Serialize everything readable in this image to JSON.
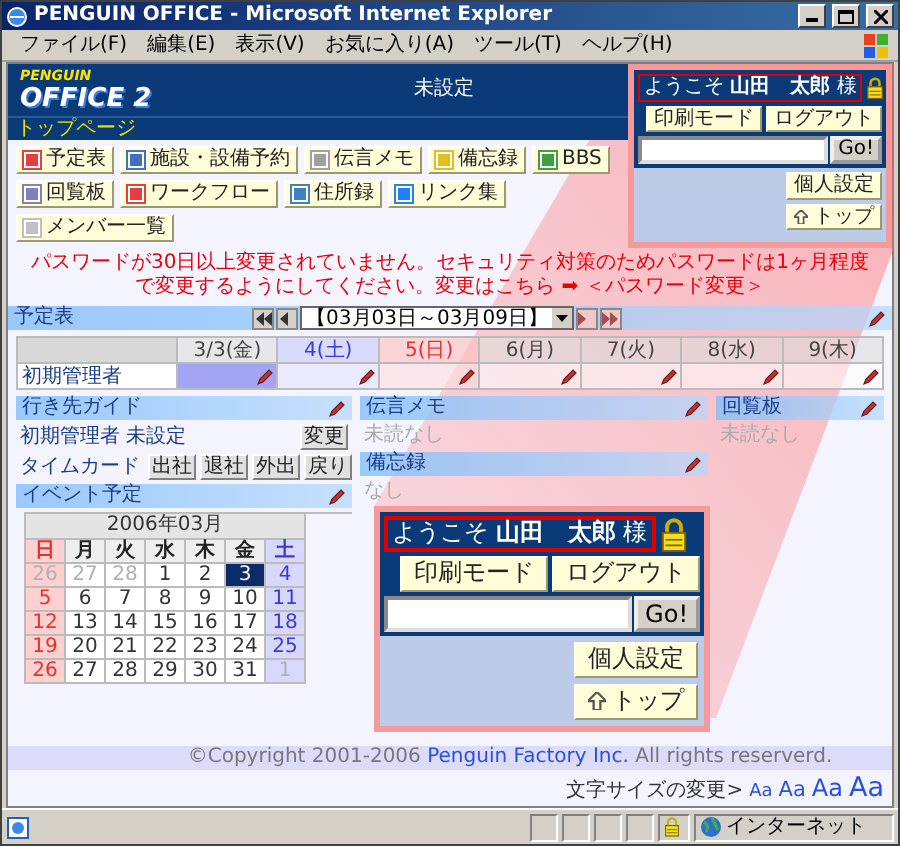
{
  "window": {
    "title": "PENGUIN OFFICE - Microsoft Internet Explorer"
  },
  "menu": [
    "ファイル(F)",
    "編集(E)",
    "表示(V)",
    "お気に入り(A)",
    "ツール(T)",
    "ヘルプ(H)"
  ],
  "logo": {
    "top": "PENGUIN",
    "bottom": "OFFICE 2"
  },
  "page_title": "未設定",
  "breadcrumb": "トップページ",
  "app_buttons": [
    "予定表",
    "施設・設備予約",
    "伝言メモ",
    "備忘録",
    "BBS",
    "回覧板",
    "ワークフロー",
    "住所録",
    "リンク集",
    "メンバー一覧"
  ],
  "user_panel": {
    "welcome": "ようこそ **山田　太郎** 様",
    "buttons": [
      "印刷モード",
      "ログアウト"
    ],
    "search_button": "Go!",
    "settings_button": "個人設定",
    "top_button": "トップ"
  },
  "warning": {
    "text": "パスワードが30日以上変更されていません。セキュリティ対策のためパスワードは1ヶ月程度で変更するようにしてください。変更はこちら ➡",
    "link": "＜パスワード変更＞"
  },
  "schedule": {
    "title": "予定表",
    "range": "【03月03日～03月09日】",
    "days": [
      {
        "label": "3/3(金)",
        "kind": "weekday",
        "selected": true
      },
      {
        "label": "4(土)",
        "kind": "saturday",
        "selected": false
      },
      {
        "label": "5(日)",
        "kind": "sunday",
        "selected": false
      },
      {
        "label": "6(月)",
        "kind": "weekday",
        "selected": false
      },
      {
        "label": "7(火)",
        "kind": "weekday",
        "selected": false
      },
      {
        "label": "8(水)",
        "kind": "weekday",
        "selected": false
      },
      {
        "label": "9(木)",
        "kind": "weekday",
        "selected": false
      }
    ],
    "rows": [
      {
        "name": "初期管理者"
      }
    ]
  },
  "destination_guide": {
    "title": "行き先ガイド",
    "person": "初期管理者 未設定",
    "change_button": "変更",
    "timecard_label": "タイムカード",
    "timecard_buttons": [
      "出社",
      "退社",
      "外出",
      "戻り"
    ]
  },
  "message_memo": {
    "title": "伝言メモ",
    "text": "未読なし"
  },
  "memo": {
    "title": "備忘録",
    "text": "なし"
  },
  "circular": {
    "title": "回覧板",
    "text": "未読なし"
  },
  "events": {
    "title": "イベント予定",
    "month": "2006年03月",
    "weekdays": [
      {
        "label": "日",
        "kind": "sunday"
      },
      {
        "label": "月",
        "kind": "weekday"
      },
      {
        "label": "火",
        "kind": "weekday"
      },
      {
        "label": "水",
        "kind": "weekday"
      },
      {
        "label": "木",
        "kind": "weekday"
      },
      {
        "label": "金",
        "kind": "weekday"
      },
      {
        "label": "土",
        "kind": "saturday"
      }
    ],
    "weeks": [
      [
        {
          "day": "26",
          "outside": true,
          "selected": false
        },
        {
          "day": "27",
          "outside": true,
          "selected": false
        },
        {
          "day": "28",
          "outside": true,
          "selected": false
        },
        {
          "day": "1",
          "outside": false,
          "selected": false
        },
        {
          "day": "2",
          "outside": false,
          "selected": false
        },
        {
          "day": "3",
          "outside": false,
          "selected": true
        },
        {
          "day": "4",
          "outside": false,
          "selected": false
        }
      ],
      [
        {
          "day": "5",
          "outside": false,
          "selected": false
        },
        {
          "day": "6",
          "outside": false,
          "selected": false
        },
        {
          "day": "7",
          "outside": false,
          "selected": false
        },
        {
          "day": "8",
          "outside": false,
          "selected": false
        },
        {
          "day": "9",
          "outside": false,
          "selected": false
        },
        {
          "day": "10",
          "outside": false,
          "selected": false
        },
        {
          "day": "11",
          "outside": false,
          "selected": false
        }
      ],
      [
        {
          "day": "12",
          "outside": false,
          "selected": false
        },
        {
          "day": "13",
          "outside": false,
          "selected": false
        },
        {
          "day": "14",
          "outside": false,
          "selected": false
        },
        {
          "day": "15",
          "outside": false,
          "selected": false
        },
        {
          "day": "16",
          "outside": false,
          "selected": false
        },
        {
          "day": "17",
          "outside": false,
          "selected": false
        },
        {
          "day": "18",
          "outside": false,
          "selected": false
        }
      ],
      [
        {
          "day": "19",
          "outside": false,
          "selected": false
        },
        {
          "day": "20",
          "outside": false,
          "selected": false
        },
        {
          "day": "21",
          "outside": false,
          "selected": false
        },
        {
          "day": "22",
          "outside": false,
          "selected": false
        },
        {
          "day": "23",
          "outside": false,
          "selected": false
        },
        {
          "day": "24",
          "outside": false,
          "selected": false
        },
        {
          "day": "25",
          "outside": false,
          "selected": false
        }
      ],
      [
        {
          "day": "26",
          "outside": false,
          "selected": false
        },
        {
          "day": "27",
          "outside": false,
          "selected": false
        },
        {
          "day": "28",
          "outside": false,
          "selected": false
        },
        {
          "day": "29",
          "outside": false,
          "selected": false
        },
        {
          "day": "30",
          "outside": false,
          "selected": false
        },
        {
          "day": "31",
          "outside": false,
          "selected": false
        },
        {
          "day": "1",
          "outside": true,
          "selected": false
        }
      ]
    ]
  },
  "callout": {
    "welcome": "ようこそ **山田　太郎** 様",
    "buttons": [
      "印刷モード",
      "ログアウト"
    ],
    "search_button": "Go!",
    "settings_button": "個人設定",
    "top_button": "トップ"
  },
  "footer": {
    "copyright_before": "©Copyright 2001-2006",
    "company_link": "Penguin Factory Inc.",
    "copyright_after": "All rights reserverd.",
    "font_size_label": "文字サイズの変更>",
    "font_sizes": [
      "Aa",
      "Aa",
      "Aa",
      "Aa"
    ]
  },
  "status_bar": {
    "zone": "インターネット"
  }
}
